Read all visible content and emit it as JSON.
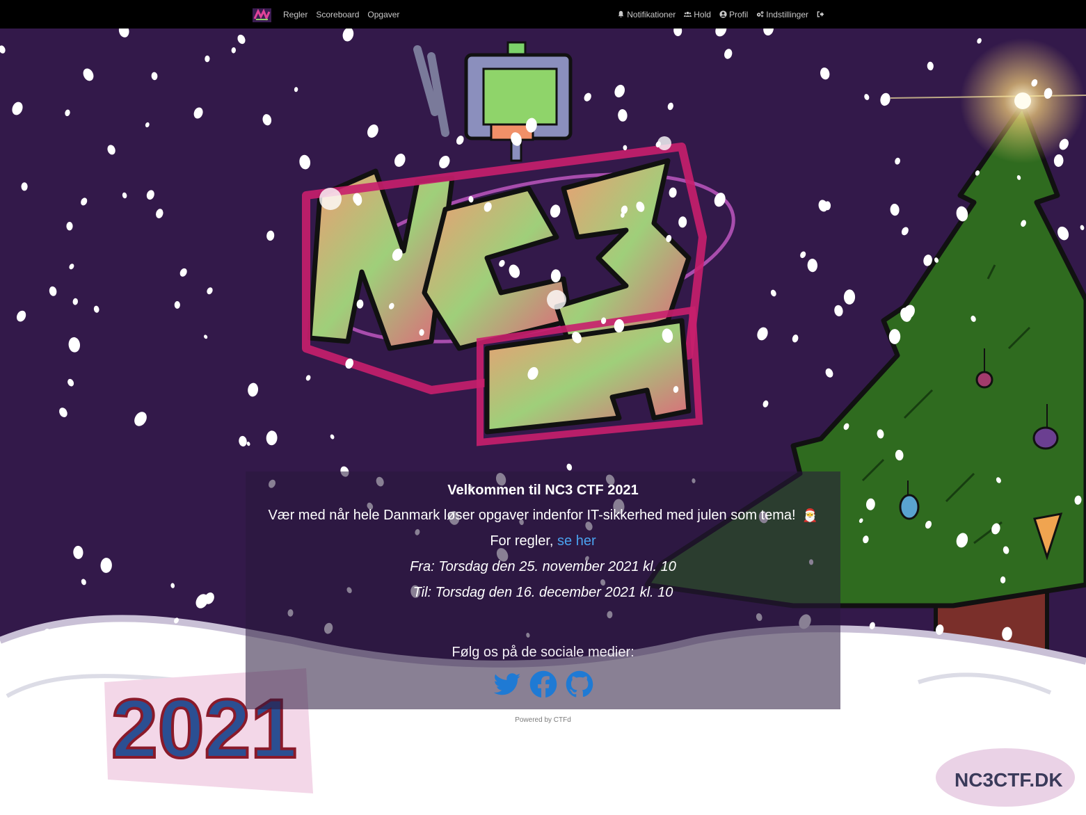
{
  "nav": {
    "left": [
      {
        "label": "Regler",
        "icon": "none"
      },
      {
        "label": "Scoreboard",
        "icon": "none"
      },
      {
        "label": "Opgaver",
        "icon": "none"
      }
    ],
    "right": [
      {
        "label": "Notifikationer",
        "icon": "bell-icon"
      },
      {
        "label": "Hold",
        "icon": "users-icon"
      },
      {
        "label": "Profil",
        "icon": "user-circle-icon"
      },
      {
        "label": "Indstillinger",
        "icon": "cogs-icon"
      },
      {
        "label": "",
        "icon": "sign-out-icon"
      }
    ]
  },
  "logo": {
    "text": "NC3 CTF"
  },
  "welcome": {
    "title": "Velkommen til NC3 CTF 2021",
    "line1": "Vær med når hele Danmark løser opgaver indenfor IT-sikkerhed med julen som tema!",
    "line1_emoji": "🎅",
    "rules_prefix": "For regler, ",
    "rules_link": "se her",
    "from": "Fra: Torsdag den 25. november 2021 kl. 10",
    "to": "Til: Torsdag den 16. december 2021 kl. 10",
    "social_text": "Følg os på de sociale medier:"
  },
  "social": [
    "twitter-icon",
    "facebook-icon",
    "github-icon"
  ],
  "footer": {
    "powered": "Powered by CTFd"
  },
  "decor": {
    "year": "2021",
    "site": "NC3CTF.DK"
  },
  "colors": {
    "background": "#33194a",
    "snow": "#ffffff",
    "tree": "#2f6b1f",
    "link": "#4aa2ef",
    "social": "#1f7ad4"
  }
}
